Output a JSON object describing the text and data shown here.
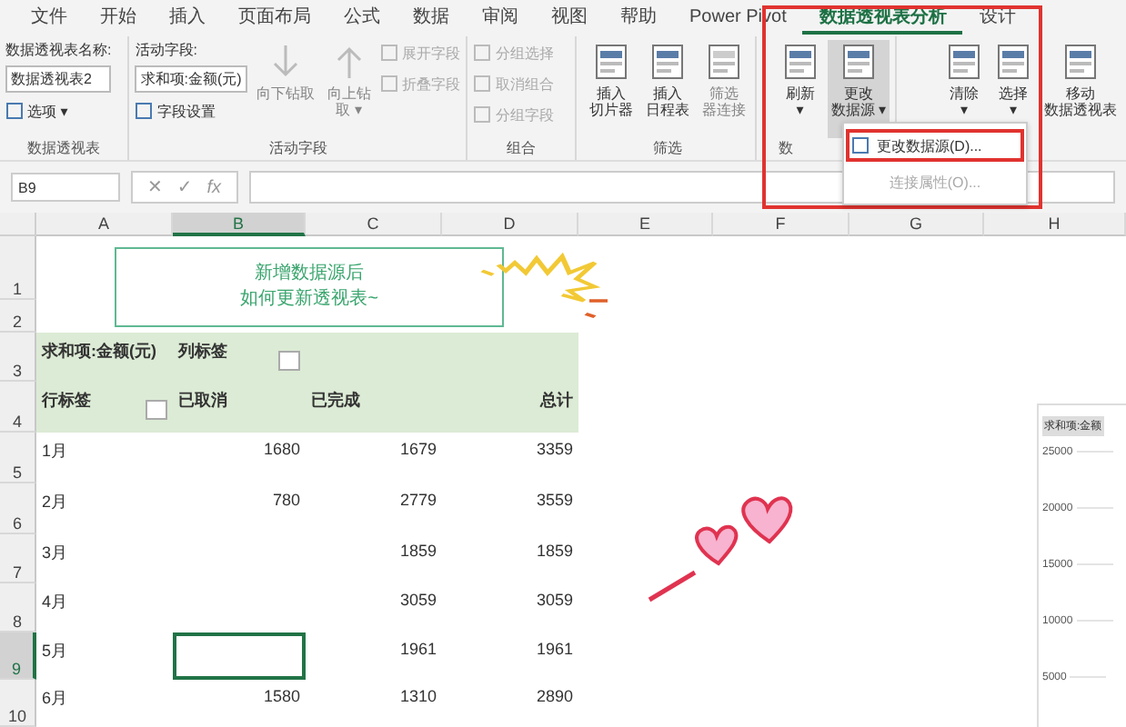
{
  "menu_tabs": [
    {
      "label": "文件",
      "selected": false
    },
    {
      "label": "开始",
      "selected": false
    },
    {
      "label": "插入",
      "selected": false
    },
    {
      "label": "页面布局",
      "selected": false
    },
    {
      "label": "公式",
      "selected": false
    },
    {
      "label": "数据",
      "selected": false
    },
    {
      "label": "审阅",
      "selected": false
    },
    {
      "label": "视图",
      "selected": false
    },
    {
      "label": "帮助",
      "selected": false
    },
    {
      "label": "Power Pivot",
      "selected": false
    },
    {
      "label": "数据透视表分析",
      "selected": true
    },
    {
      "label": "设计",
      "selected": false
    }
  ],
  "ribbon_groups": [
    {
      "kind": "pivot_name",
      "label": "数据透视表",
      "field_label": "数据透视表名称:",
      "value": "数据透视表2",
      "button": "选项 ▾"
    },
    {
      "kind": "active_field",
      "label": "活动字段",
      "field_label": "活动字段:",
      "value": "求和项:金额(元)",
      "button": "字段设置",
      "large": [
        {
          "lines": [
            "向下钻取"
          ],
          "disabled": true
        },
        {
          "lines": [
            "向上钻",
            "取 ▾"
          ],
          "disabled": true
        }
      ],
      "small": [
        {
          "label": "展开字段",
          "disabled": true
        },
        {
          "label": "折叠字段",
          "disabled": true
        }
      ]
    },
    {
      "kind": "small_list",
      "label": "组合",
      "small": [
        {
          "label": "分组选择",
          "disabled": true
        },
        {
          "label": "取消组合",
          "disabled": true
        },
        {
          "label": "分组字段",
          "disabled": true
        }
      ]
    },
    {
      "kind": "large_buttons",
      "label": "筛选",
      "large": [
        {
          "lines": [
            "插入",
            "切片器"
          ],
          "disabled": false,
          "pressed": false
        },
        {
          "lines": [
            "插入",
            "日程表"
          ],
          "disabled": false,
          "pressed": false
        },
        {
          "lines": [
            "筛选",
            "器连接"
          ],
          "disabled": true,
          "pressed": false
        }
      ]
    },
    {
      "kind": "large_buttons",
      "label": "数",
      "large": [
        {
          "lines": [
            "刷新",
            "▾"
          ],
          "disabled": false,
          "pressed": false
        },
        {
          "lines": [
            "更改",
            "数据源 ▾"
          ],
          "disabled": false,
          "pressed": true
        }
      ]
    },
    {
      "kind": "large_buttons",
      "large": [
        {
          "lines": [
            "清除",
            "▾"
          ],
          "disabled": false,
          "pressed": false
        },
        {
          "lines": [
            "选择",
            "▾"
          ],
          "disabled": false,
          "pressed": false
        },
        {
          "lines": [
            "移动",
            "数据透视表"
          ],
          "disabled": false,
          "pressed": false
        }
      ]
    }
  ],
  "dropdown_menu": [
    {
      "label": "更改数据源(D)...",
      "disabled": false
    },
    {
      "label": "连接属性(O)...",
      "disabled": true
    }
  ],
  "name_box": "B9",
  "formula_buttons": [
    "✕",
    "✓",
    "fx"
  ],
  "columns": [
    {
      "label": "A",
      "selected": false
    },
    {
      "label": "B",
      "selected": true
    },
    {
      "label": "C",
      "selected": false
    },
    {
      "label": "D",
      "selected": false
    },
    {
      "label": "E",
      "selected": false
    },
    {
      "label": "F",
      "selected": false
    },
    {
      "label": "G",
      "selected": false
    },
    {
      "label": "H",
      "selected": false
    }
  ],
  "row_numbers": [
    {
      "label": "1",
      "selected": false
    },
    {
      "label": "2",
      "selected": false
    },
    {
      "label": "3",
      "selected": false
    },
    {
      "label": "4",
      "selected": false
    },
    {
      "label": "5",
      "selected": false
    },
    {
      "label": "6",
      "selected": false
    },
    {
      "label": "7",
      "selected": false
    },
    {
      "label": "8",
      "selected": false
    },
    {
      "label": "9",
      "selected": true
    },
    {
      "label": "10",
      "selected": false
    }
  ],
  "callout": [
    "新增数据源后",
    "如何更新透视表~"
  ],
  "pivot": {
    "title": "求和项:金额(元)",
    "column_label": "列标签",
    "row_label": "行标签",
    "columns": [
      "已取消",
      "已完成",
      "总计"
    ],
    "rows": [
      {
        "label": "1月",
        "cancelled": "1680",
        "completed": "1679",
        "total": "3359"
      },
      {
        "label": "2月",
        "cancelled": "780",
        "completed": "2779",
        "total": "3559"
      },
      {
        "label": "3月",
        "completed": "1859",
        "total": "1859"
      },
      {
        "label": "4月",
        "completed": "3059",
        "total": "3059"
      },
      {
        "label": "5月",
        "completed": "1961",
        "total": "1961"
      },
      {
        "label": "6月",
        "cancelled": "1580",
        "completed": "1310",
        "total": "2890"
      }
    ]
  },
  "chart_fragment": {
    "title": "求和项:金额",
    "axis_labels": [
      "25000",
      "20000",
      "15000",
      "10000",
      "5000"
    ]
  }
}
